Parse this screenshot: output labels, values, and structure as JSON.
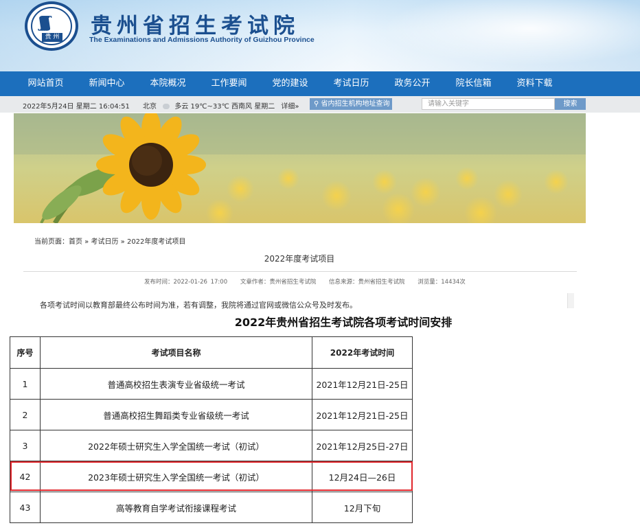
{
  "header": {
    "site_title": "贵州省招生考试院",
    "site_subtitle": "The Examinations and Admissions Authority of Guizhou Province",
    "logo_tag": "贵 州",
    "logo_mark": "ʃʃʃʃ"
  },
  "nav": {
    "items": [
      "网站首页",
      "新闻中心",
      "本院概况",
      "工作要闻",
      "党的建设",
      "考试日历",
      "政务公开",
      "院长信箱",
      "资料下载"
    ]
  },
  "infobar": {
    "datetime": "2022年5月24日  星期二  16:04:51",
    "city": "北京",
    "weather": "多云 19℃~33℃  西南风  星期二",
    "detail": "详细»",
    "address_button": "省内招生机构地址查询",
    "search_placeholder": "请输入关键字",
    "search_button": "搜索"
  },
  "breadcrumb": "当前页面：首页 » 考试日历 » 2022年度考试项目",
  "article": {
    "title": "2022年度考试项目",
    "publish_time": "发布时间：2022-01-26 17:00",
    "author": "文章作者：贵州省招生考试院",
    "source": "信息来源：贵州省招生考试院",
    "views": "浏览量：14434次",
    "notice": "各项考试时间以教育部最终公布时间为准，若有调整，我院将通过官网或微信公众号及时发布。"
  },
  "table": {
    "title": "2022年贵州省招生考试院各项考试时间安排",
    "headers": [
      "序号",
      "考试项目名称",
      "2022年考试时间"
    ],
    "rows": [
      [
        "1",
        "普通高校招生表演专业省级统一考试",
        "2021年12月21日-25日"
      ],
      [
        "2",
        "普通高校招生舞蹈类专业省级统一考试",
        "2021年12月21日-25日"
      ],
      [
        "3",
        "2022年硕士研究生入学全国统一考试（初试）",
        "2021年12月25日-27日"
      ],
      [
        "42",
        "2023年硕士研究生入学全国统一考试（初试）",
        "12月24日—26日"
      ],
      [
        "43",
        "高等教育自学考试衔接课程考试",
        "12月下旬"
      ]
    ],
    "highlight_color": "#e0262b"
  },
  "colors": {
    "nav_bg": "#1c6fbd",
    "brand": "#1b4f8f",
    "button": "#6e9ac9"
  }
}
